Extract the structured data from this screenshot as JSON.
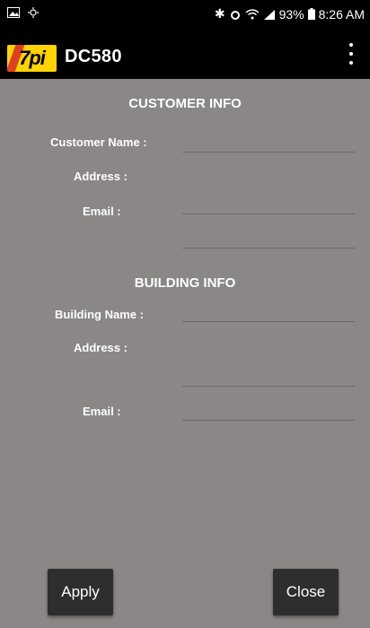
{
  "status_bar": {
    "left_icons": [
      "image-icon",
      "notification-icon"
    ],
    "bluetooth": "✱",
    "battery_percent": "93%",
    "time": "8:26 AM"
  },
  "app": {
    "logo_text": "7pi",
    "title": "DC580",
    "menu_icon": "overflow-menu-icon"
  },
  "customer": {
    "section_title": "CUSTOMER INFO",
    "name_label": "Customer Name :",
    "name_value": "",
    "address_label": "Address :",
    "address_value": "",
    "email_label": "Email :",
    "email_value": "",
    "extra_value": ""
  },
  "building": {
    "section_title": "BUILDING INFO",
    "name_label": "Building Name :",
    "name_value": "",
    "address_label": "Address :",
    "address_value": "",
    "email_label": "Email :",
    "email_value": ""
  },
  "buttons": {
    "apply": "Apply",
    "close": "Close"
  }
}
